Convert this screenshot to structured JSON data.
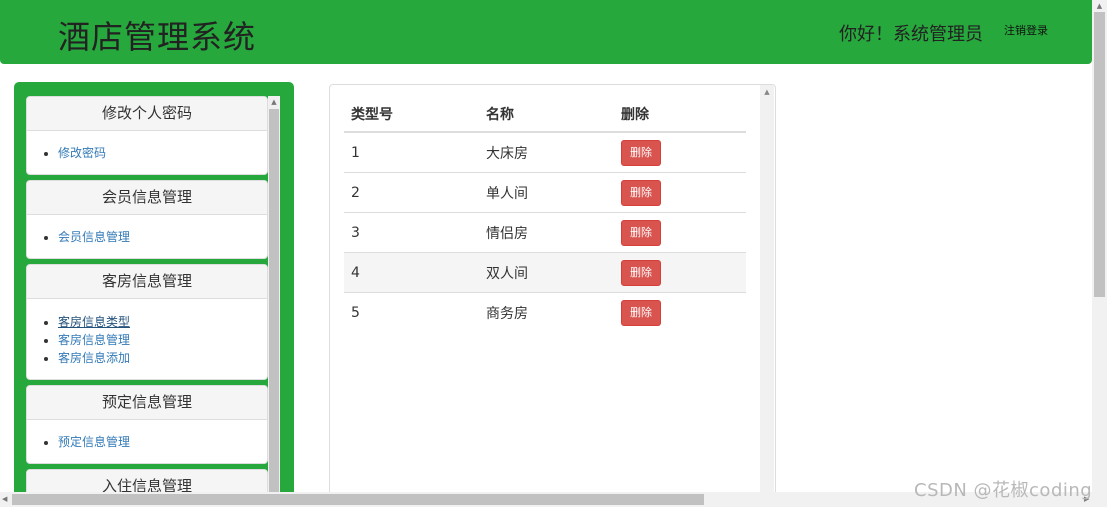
{
  "header": {
    "title": "酒店管理系统",
    "greeting": "你好！系统管理员",
    "logout_label": "注销登录",
    "bg_color": "#26a83c"
  },
  "sidebar": {
    "panels": [
      {
        "heading": "修改个人密码",
        "items": [
          "修改密码"
        ]
      },
      {
        "heading": "会员信息管理",
        "items": [
          "会员信息管理"
        ]
      },
      {
        "heading": "客房信息管理",
        "items": [
          "客房信息类型",
          "客房信息管理",
          "客房信息添加"
        ]
      },
      {
        "heading": "预定信息管理",
        "items": [
          "预定信息管理"
        ]
      },
      {
        "heading": "入住信息管理",
        "items": []
      }
    ]
  },
  "table": {
    "headers": [
      "类型号",
      "名称",
      "删除"
    ],
    "delete_label": "删除",
    "rows": [
      {
        "id": "1",
        "name": "大床房"
      },
      {
        "id": "2",
        "name": "单人间"
      },
      {
        "id": "3",
        "name": "情侣房"
      },
      {
        "id": "4",
        "name": "双人间"
      },
      {
        "id": "5",
        "name": "商务房"
      }
    ]
  },
  "watermark": "CSDN @花椒coding",
  "colors": {
    "accent": "#26a83c",
    "danger": "#d9534f",
    "link": "#337ab7"
  },
  "icons": {
    "scroll_up": "▲",
    "scroll_left": "◀",
    "scroll_right": "▶"
  }
}
